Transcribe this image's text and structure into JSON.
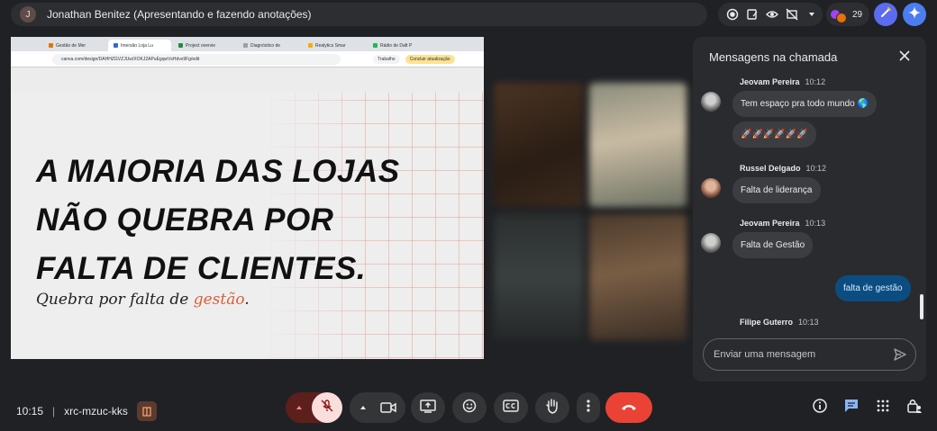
{
  "header": {
    "presenter_initial": "J",
    "presenter_label": "Jonathan Benitez (Apresentando e fazendo anotações)",
    "people_count": "29",
    "icons": [
      "record-icon",
      "notes-icon",
      "eye-icon",
      "no-photo-icon",
      "chevron-down-icon",
      "pen-icon",
      "gemini-icon"
    ]
  },
  "shared_screen": {
    "browser_tabs": [
      "Gestão de Mer",
      "Imersão Loja Lu",
      "Project overvie",
      "Diagnóstico de",
      "Realytics Smar",
      "Rádio de Daft P"
    ],
    "url": "canva.com/design/DAHHZGVZJUw/XOKJ2APuEgqwVsHdvx9Fg/edit",
    "profile_chip": "Trabalho",
    "finish_button": "Concluir atualização",
    "slide": {
      "line1": "A MAIORIA DAS LOJAS",
      "line2": "NÃO QUEBRA POR",
      "line3": "FALTA DE CLIENTES.",
      "subtitle_start": "Quebra por falta de ",
      "subtitle_accent": "gestão",
      "subtitle_end": ".",
      "accent_color": "#d9603b"
    }
  },
  "chat": {
    "title": "Mensagens na chamada",
    "messages": [
      {
        "sender": "Jeovam Pereira",
        "time": "10:12",
        "texts": [
          "Tem espaço pra todo mundo 🌎",
          "🚀🚀🚀🚀🚀🚀"
        ]
      },
      {
        "sender": "Russel Delgado",
        "time": "10:12",
        "texts": [
          "Falta de liderança"
        ]
      },
      {
        "sender": "Jeovam Pereira",
        "time": "10:13",
        "texts": [
          "Falta de Gestão"
        ]
      },
      {
        "own": true,
        "texts": [
          "falta de gestão"
        ]
      },
      {
        "sender": "Filipe Guterro",
        "time": "10:13",
        "texts": []
      }
    ],
    "input_placeholder": "Enviar uma mensagem"
  },
  "footer": {
    "time": "10:15",
    "meeting_code": "xrc-mzuc-kks"
  },
  "colors": {
    "end_call": "#ea4335",
    "mic_off": "#f9dedc",
    "own_bubble": "#0b4d80"
  }
}
